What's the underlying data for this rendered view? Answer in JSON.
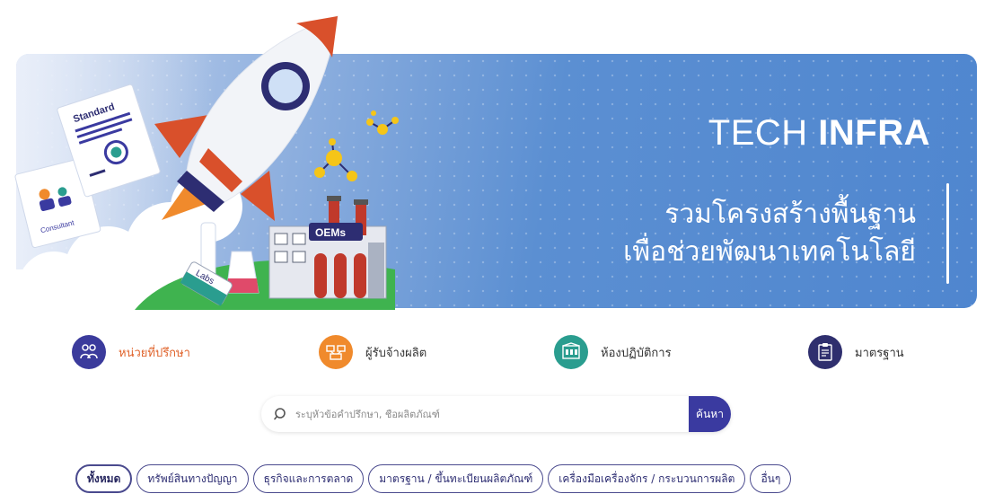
{
  "hero": {
    "title_light": "TECH ",
    "title_bold": "INFRA",
    "subtitle_line1": "รวมโครงสร้างพื้นฐาน",
    "subtitle_line2": "เพื่อช่วยพัฒนาเทคโนโลยี",
    "art_labels": {
      "standard": "Standard",
      "consultant": "Consultant",
      "oems": "OEMs",
      "labs": "Labs"
    }
  },
  "categories": [
    {
      "label": "หน่วยที่ปรึกษา",
      "icon": "consultant-icon",
      "color": "#3b3b9c",
      "active": true
    },
    {
      "label": "ผู้รับจ้างผลิต",
      "icon": "manufacturer-icon",
      "color": "#f08a2c",
      "active": false
    },
    {
      "label": "ห้องปฏิบัติการ",
      "icon": "laboratory-icon",
      "color": "#2a9d8f",
      "active": false
    },
    {
      "label": "มาตรฐาน",
      "icon": "standard-icon",
      "color": "#2f2f6e",
      "active": false
    }
  ],
  "search": {
    "placeholder": "ระบุหัวข้อคำปรึกษา, ชื่อผลิตภัณฑ์",
    "value": "",
    "button_label": "ค้นหา"
  },
  "filters": [
    {
      "label": "ทั้งหมด",
      "active": true
    },
    {
      "label": "ทรัพย์สินทางปัญญา",
      "active": false
    },
    {
      "label": "ธุรกิจและการตลาด",
      "active": false
    },
    {
      "label": "มาตรฐาน / ขึ้นทะเบียนผลิตภัณฑ์",
      "active": false
    },
    {
      "label": "เครื่องมือเครื่องจักร / กระบวนการผลิต",
      "active": false
    },
    {
      "label": "อื่นๆ",
      "active": false
    }
  ],
  "colors": {
    "brand_primary": "#3a3aa0",
    "accent_orange": "#e0642c",
    "hero_blue": "#5b8fd2"
  }
}
